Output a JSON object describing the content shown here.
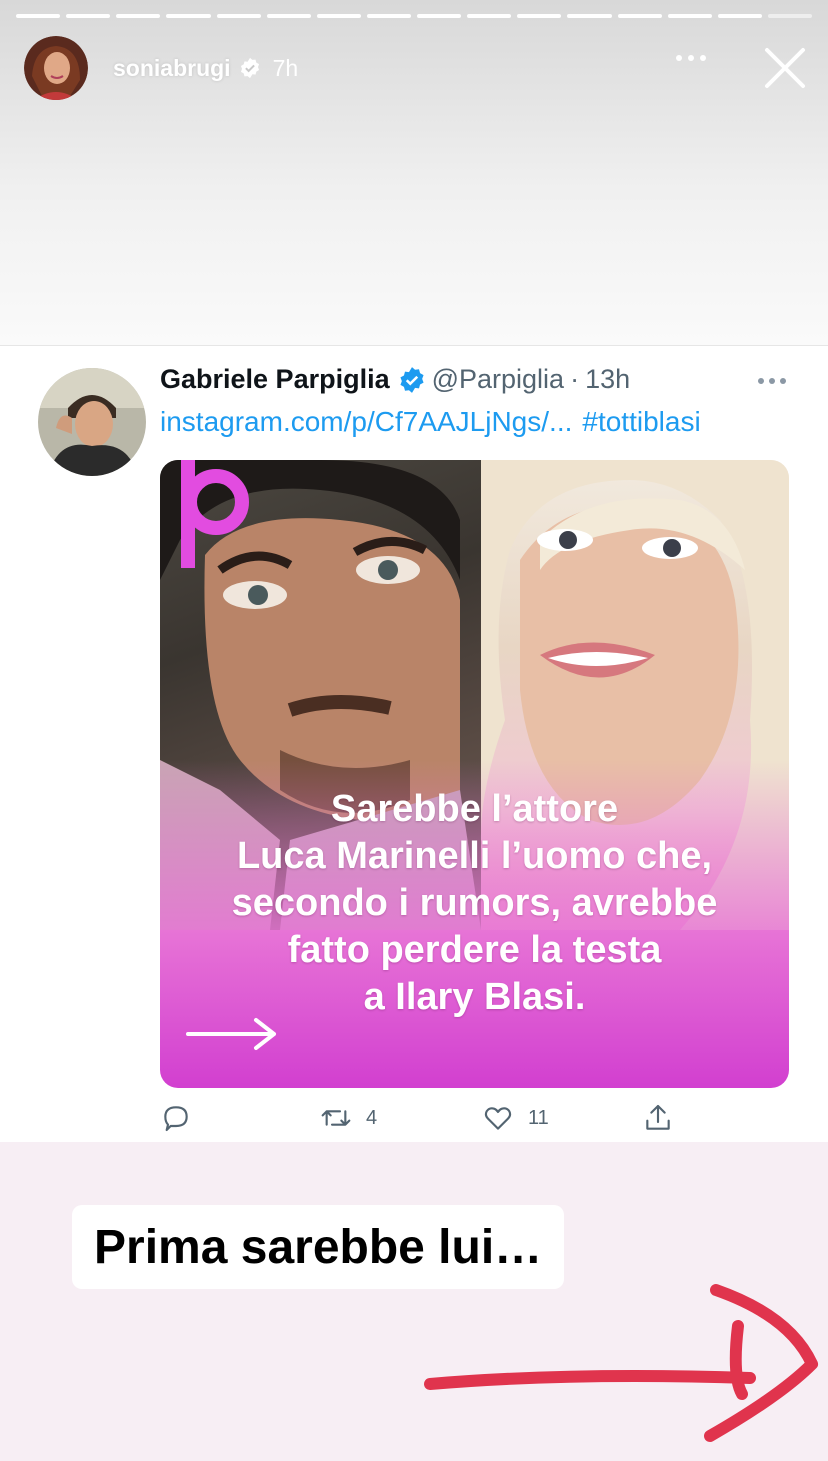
{
  "story": {
    "username": "soniabrugi",
    "time": "7h",
    "progress_segments": 16,
    "progress_done": 15
  },
  "tweet": {
    "author_name": "Gabriele Parpiglia",
    "handle": "@Parpiglia",
    "separator": "·",
    "time": "13h",
    "link": "instagram.com/p/Cf7AAJLjNgs/...",
    "hashtag": "#tottiblasi",
    "media_caption": [
      "Sarebbe l’attore",
      "Luca Marinelli l’uomo che,",
      "secondo i rumors, avrebbe",
      "fatto perdere la testa",
      "a Ilary Blasi."
    ],
    "retweets": "4",
    "likes": "11"
  },
  "sticker": {
    "text": "Prima sarebbe lui…"
  },
  "colors": {
    "twitter_blue": "#1d9bf0",
    "media_magenta": "#d23fd0",
    "drawn_arrow": "#e0344d"
  },
  "icons": [
    "verified-badge-icon",
    "more-icon",
    "close-icon",
    "reply-icon",
    "retweet-icon",
    "like-icon",
    "share-icon",
    "arrow-right-icon"
  ]
}
